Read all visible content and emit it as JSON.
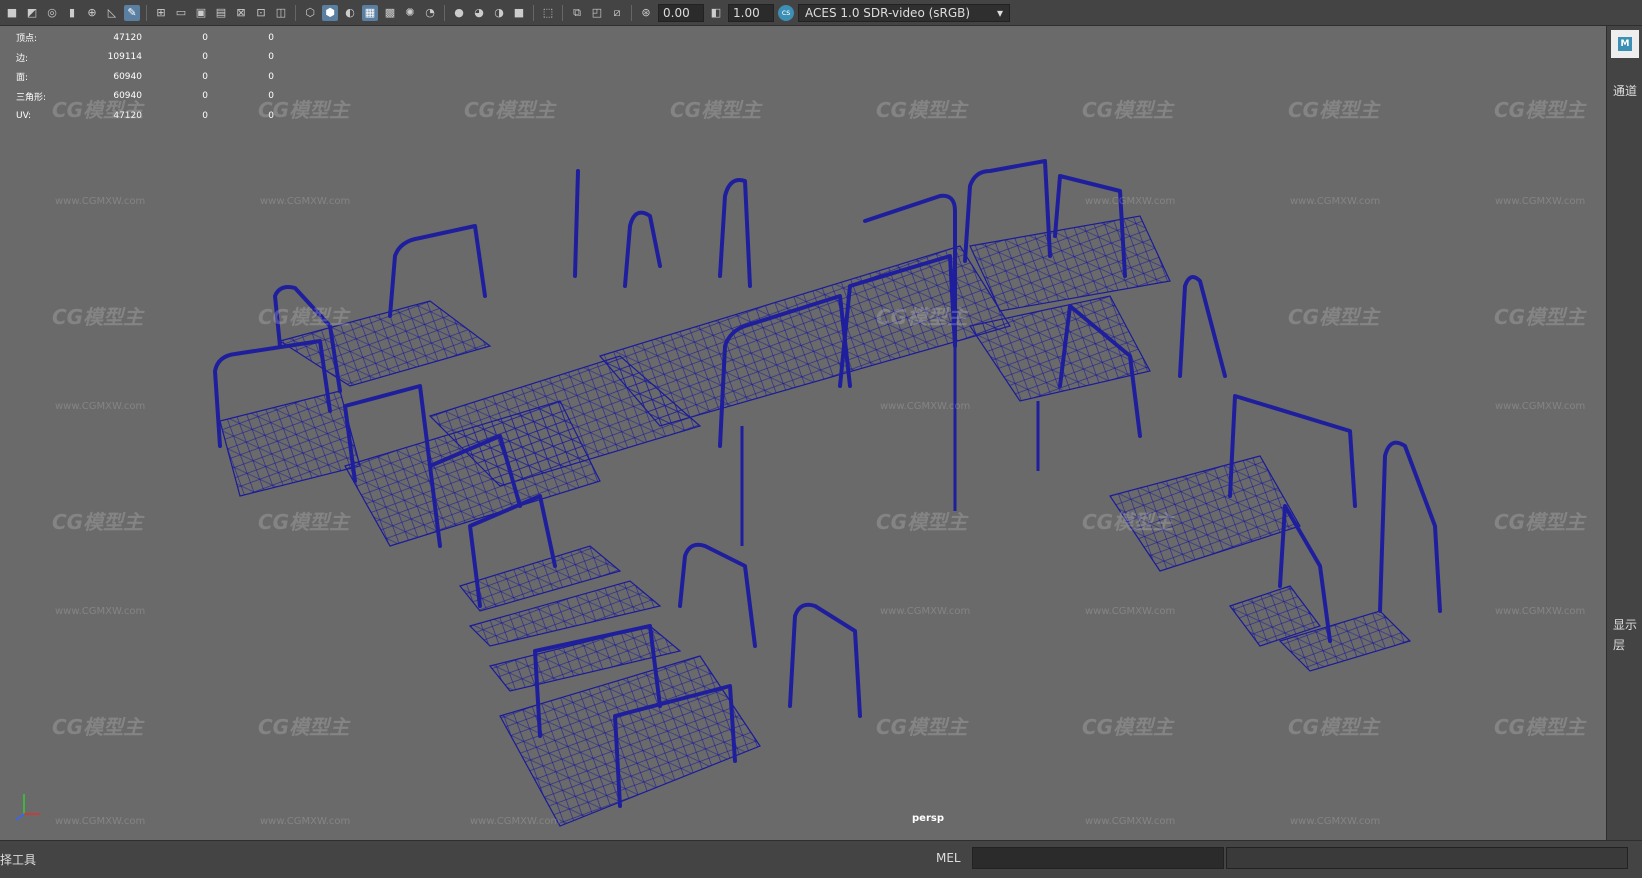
{
  "toolbar": {
    "exposure_value": "0.00",
    "gamma_value": "1.00",
    "color_space": "ACES 1.0 SDR-video (sRGB)",
    "icons": [
      "camera-icon",
      "camera-attributes-icon",
      "bookmark-icon",
      "image-plane-icon",
      "grid-icon",
      "film-gate-icon",
      "resolution-gate-icon",
      "gate-mask-icon",
      "field-chart-icon",
      "safe-action-icon",
      "wireframe-icon",
      "smooth-shade-icon",
      "default-material-icon",
      "textured-icon",
      "lights-icon",
      "shadows-icon",
      "ambient-occlusion-icon",
      "motion-blur-icon",
      "anti-alias-icon",
      "depth-of-field-icon",
      "isolate-select-icon",
      "xray-icon",
      "xray-joints-icon",
      "backface-icon",
      "exposure-icon",
      "gamma-icon",
      "color-management-icon"
    ]
  },
  "hud": {
    "rows": [
      {
        "label": "顶点:",
        "value": "47120",
        "sel": "0",
        "extra": "0"
      },
      {
        "label": "边:",
        "value": "109114",
        "sel": "0",
        "extra": "0"
      },
      {
        "label": "面:",
        "value": "60940",
        "sel": "0",
        "extra": "0"
      },
      {
        "label": "三角形:",
        "value": "60940",
        "sel": "0",
        "extra": "0"
      },
      {
        "label": "UV:",
        "value": "47120",
        "sel": "0",
        "extra": "0"
      }
    ]
  },
  "viewport": {
    "camera_label": "persp",
    "watermark": "CG模型主",
    "watermark_url": "www.CGMXW.com",
    "wire_color": "#1b1b9a",
    "background": "#6a6a6a"
  },
  "right_panel": {
    "channel_label": "通道",
    "display_label": "显示",
    "layer_label": "层"
  },
  "bottom": {
    "status_text": "择工具",
    "mel_label": "MEL"
  }
}
